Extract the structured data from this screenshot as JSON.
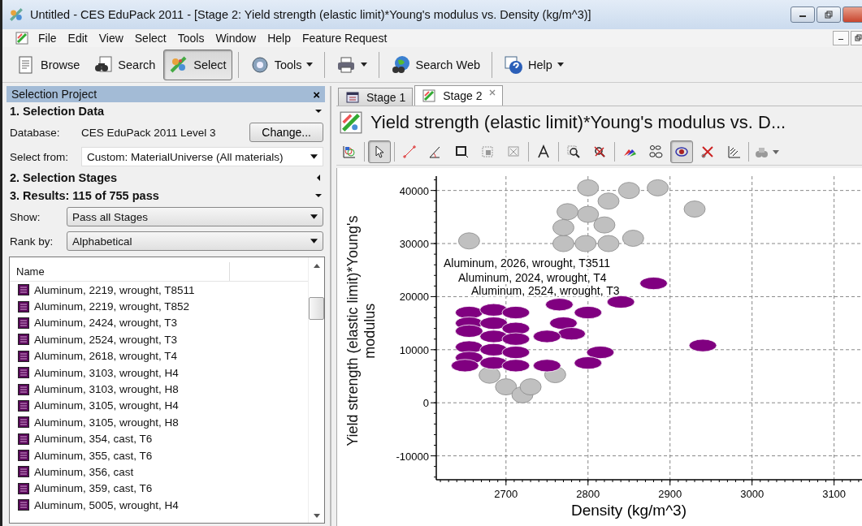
{
  "window": {
    "title": "Untitled - CES EduPack 2011 - [Stage 2: Yield strength (elastic limit)*Young's modulus vs. Density (kg/m^3)]"
  },
  "menu": [
    "File",
    "Edit",
    "View",
    "Select",
    "Tools",
    "Window",
    "Help",
    "Feature Request"
  ],
  "toolbar": [
    {
      "kind": "browse",
      "label": "Browse",
      "pressed": false,
      "dropdown": false
    },
    {
      "kind": "search",
      "label": "Search",
      "pressed": false,
      "dropdown": false
    },
    {
      "kind": "select",
      "label": "Select",
      "pressed": true,
      "dropdown": false
    },
    {
      "kind": "separator"
    },
    {
      "kind": "tools",
      "label": "Tools",
      "pressed": false,
      "dropdown": true
    },
    {
      "kind": "separator"
    },
    {
      "kind": "print",
      "pressed": false,
      "dropdown": true
    },
    {
      "kind": "separator"
    },
    {
      "kind": "web",
      "label": "Search Web",
      "pressed": false,
      "dropdown": false
    },
    {
      "kind": "separator"
    },
    {
      "kind": "help",
      "label": "Help",
      "pressed": false,
      "dropdown": true
    }
  ],
  "panel": {
    "title": "Selection Project",
    "close": "×",
    "sections": [
      {
        "title": "1. Selection Data",
        "expanded": true
      },
      {
        "title": "2. Selection Stages",
        "expanded": false
      },
      {
        "title": "3. Results: 115 of 755 pass",
        "expanded": true
      }
    ],
    "database": {
      "label": "Database:",
      "value": "CES EduPack 2011 Level 3",
      "button": "Change..."
    },
    "select_from": {
      "label": "Select from:",
      "value": "Custom: MaterialUniverse (All materials)"
    },
    "show": {
      "label": "Show:",
      "value": "Pass all Stages"
    },
    "rank_by": {
      "label": "Rank by:",
      "value": "Alphabetical"
    },
    "results": {
      "columns": [
        "Name"
      ],
      "rows": [
        "Aluminum, 2219, wrought, T8511",
        "Aluminum, 2219, wrought, T852",
        "Aluminum, 2424, wrought, T3",
        "Aluminum, 2524, wrought, T3",
        "Aluminum, 2618, wrought, T4",
        "Aluminum, 3103, wrought, H4",
        "Aluminum, 3103, wrought, H8",
        "Aluminum, 3105, wrought, H4",
        "Aluminum, 3105, wrought, H8",
        "Aluminum, 354, cast, T6",
        "Aluminum, 355, cast, T6",
        "Aluminum, 356, cast",
        "Aluminum, 359, cast, T6",
        "Aluminum, 5005, wrought, H4"
      ]
    }
  },
  "tabs": [
    {
      "label": "Stage 1",
      "kind": "table",
      "selected": false,
      "closable": false
    },
    {
      "label": "Stage 2",
      "kind": "chart",
      "selected": true,
      "closable": true
    }
  ],
  "chart_title": "Yield strength (elastic limit)*Young's modulus vs. D...",
  "chart_tools": [
    {
      "kind": "settings",
      "pressed": false
    },
    {
      "kind": "separator"
    },
    {
      "kind": "pointer",
      "pressed": true
    },
    {
      "kind": "separator"
    },
    {
      "kind": "line",
      "pressed": false
    },
    {
      "kind": "angle",
      "pressed": false
    },
    {
      "kind": "box",
      "pressed": false
    },
    {
      "kind": "boxselect",
      "pressed": false
    },
    {
      "kind": "boxdelete",
      "pressed": false
    },
    {
      "kind": "separator"
    },
    {
      "kind": "text",
      "pressed": false
    },
    {
      "kind": "separator"
    },
    {
      "kind": "zoom",
      "pressed": false
    },
    {
      "kind": "unzoom",
      "pressed": false
    },
    {
      "kind": "separator"
    },
    {
      "kind": "colors",
      "pressed": false
    },
    {
      "kind": "labels",
      "pressed": false
    },
    {
      "kind": "eye",
      "pressed": true
    },
    {
      "kind": "cut",
      "pressed": false
    },
    {
      "kind": "hatch",
      "pressed": false
    },
    {
      "kind": "separator"
    },
    {
      "kind": "finder",
      "pressed": false
    }
  ],
  "chart": {
    "chart_data": {
      "type": "scatter",
      "xlabel": "Density (kg/m^3)",
      "ylabel": "Yield strength (elastic limit)*Young's modulus",
      "grid": true,
      "xlim": [
        2615,
        3140
      ],
      "ylim": [
        -14500,
        42700
      ],
      "xticks": [
        2700,
        2800,
        2900,
        3000,
        3100
      ],
      "yticks": [
        -10000,
        0,
        10000,
        20000,
        30000,
        40000
      ],
      "x": [
        2655,
        2770,
        2797,
        2825,
        2855,
        2770,
        2800,
        2825,
        2800,
        2850,
        2885,
        2930,
        2700,
        2720,
        2760,
        2680,
        2730,
        2775,
        2820,
        2655,
        2685,
        2712,
        2655,
        2685,
        2712,
        2655,
        2685,
        2712,
        2655,
        2685,
        2712,
        2655,
        2685,
        2712,
        2770,
        2765,
        2800,
        2840,
        2880,
        2940,
        2815,
        2800,
        2750,
        2780,
        2650,
        2750
      ],
      "series": [
        {
          "color": "#c0c0c0",
          "values": [
            30500,
            30000,
            30000,
            30000,
            31000,
            33000,
            35500,
            38000,
            40500,
            40000,
            40500,
            36500,
            3000,
            1500,
            5300,
            5200,
            3000,
            36000,
            33500,
            null,
            null,
            null,
            null,
            null,
            null,
            null,
            null,
            null,
            null,
            null,
            null,
            null,
            null,
            null,
            null,
            null,
            null,
            null,
            null,
            null,
            null,
            null,
            null,
            null,
            null,
            null
          ]
        },
        {
          "color": "#800080",
          "values": [
            null,
            null,
            null,
            null,
            null,
            null,
            null,
            null,
            null,
            null,
            null,
            null,
            null,
            null,
            null,
            null,
            null,
            null,
            null,
            17000,
            17500,
            17000,
            15000,
            15000,
            14000,
            13500,
            12500,
            12000,
            10500,
            10000,
            9500,
            8500,
            7500,
            7000,
            15000,
            18500,
            17000,
            19000,
            22500,
            10800,
            9500,
            7500,
            7000,
            13000,
            7000,
            12500
          ]
        }
      ],
      "annotations": [
        "Aluminum, 2026, wrought, T3511",
        "Aluminum, 2024, wrought, T4",
        "Aluminum, 2524, wrought, T3"
      ]
    }
  }
}
